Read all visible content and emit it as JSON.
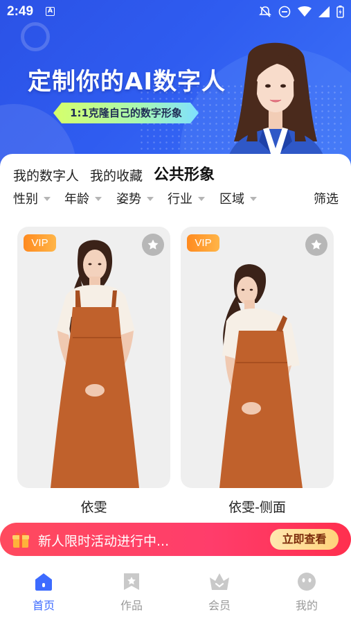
{
  "status_bar": {
    "time": "2:49",
    "badge": "A"
  },
  "banner": {
    "title": "定制你的AI数字人",
    "subtitle": "1:1克隆自己的数字形象"
  },
  "tabs": [
    {
      "label": "我的数字人",
      "active": false
    },
    {
      "label": "我的收藏",
      "active": false
    },
    {
      "label": "公共形象",
      "active": true
    }
  ],
  "filters": {
    "items": [
      "性别",
      "年龄",
      "姿势",
      "行业",
      "区域"
    ],
    "screen_label": "筛选"
  },
  "cards": [
    {
      "badge": "VIP",
      "name": "依雯",
      "pose": "front"
    },
    {
      "badge": "VIP",
      "name": "依雯-侧面",
      "pose": "side"
    }
  ],
  "promo": {
    "text": "新人限时活动进行中...",
    "button": "立即查看"
  },
  "nav": [
    {
      "label": "首页",
      "icon": "home-icon",
      "active": true
    },
    {
      "label": "作品",
      "icon": "works-icon",
      "active": false
    },
    {
      "label": "会员",
      "icon": "crown-icon",
      "active": false
    },
    {
      "label": "我的",
      "icon": "profile-icon",
      "active": false
    }
  ],
  "colors": {
    "brand_blue": "#2f5cf0",
    "vip_orange": "#ff8a1f",
    "promo_red": "#ff3d5a",
    "nav_active": "#3d6bff",
    "dress": "#c0612c"
  }
}
